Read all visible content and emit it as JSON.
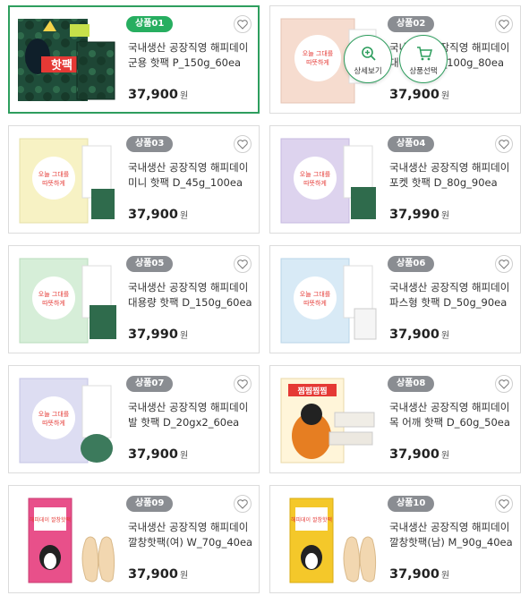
{
  "products": [
    {
      "badge": "상품01",
      "name": "국내생산 공장직영 해피데이 군용 핫팩 P_150g_60ea",
      "price": "37,900",
      "unit": "원"
    },
    {
      "badge": "상품02",
      "name": "국내생산 공장직영 해피데이 대형 핫팩 D_100g_80ea",
      "price": "37,900",
      "unit": "원"
    },
    {
      "badge": "상품03",
      "name": "국내생산 공장직영 해피데이 미니 핫팩 D_45g_100ea",
      "price": "37,900",
      "unit": "원"
    },
    {
      "badge": "상품04",
      "name": "국내생산 공장직영 해피데이 포켓 핫팩 D_80g_90ea",
      "price": "37,990",
      "unit": "원"
    },
    {
      "badge": "상품05",
      "name": "국내생산 공장직영 해피데이 대용량 핫팩 D_150g_60ea",
      "price": "37,990",
      "unit": "원"
    },
    {
      "badge": "상품06",
      "name": "국내생산 공장직영 해피데이 파스형 핫팩 D_50g_90ea",
      "price": "37,900",
      "unit": "원"
    },
    {
      "badge": "상품07",
      "name": "국내생산 공장직영 해피데이 발 핫팩 D_20gx2_60ea",
      "price": "37,900",
      "unit": "원"
    },
    {
      "badge": "상품08",
      "name": "국내생산 공장직영 해피데이 목 어깨 핫팩 D_60g_50ea",
      "price": "37,900",
      "unit": "원"
    },
    {
      "badge": "상품09",
      "name": "국내생산 공장직영 해피데이 깔창핫팩(여) W_70g_40ea",
      "price": "37,900",
      "unit": "원"
    },
    {
      "badge": "상품10",
      "name": "국내생산 공장직영 해피데이 깔창핫팩(남) M_90g_40ea",
      "price": "37,900",
      "unit": "원"
    }
  ],
  "overlay": {
    "detail_label": "상세보기",
    "select_label": "상품선택"
  },
  "thumbs": {
    "p1_title": "핫팩",
    "slogan": "오늘 그대를 따뜻하게 해드리리라",
    "p8_title": "찜찜찜찜",
    "insole_text": "해피데이 깔창핫팩"
  },
  "colors": {
    "active_border": "#2e9e5e",
    "badge_active": "#27ae60",
    "badge": "#8a8d92",
    "p2_tint": "#f6dccf",
    "p3_tint": "#f7f2c4",
    "p4_tint": "#ddd3ee",
    "p5_tint": "#d6eed8",
    "p6_tint": "#d8eaf6",
    "p7_tint": "#ddddf2",
    "p9_tint": "#e8508a",
    "p10_tint": "#f4c82a"
  }
}
